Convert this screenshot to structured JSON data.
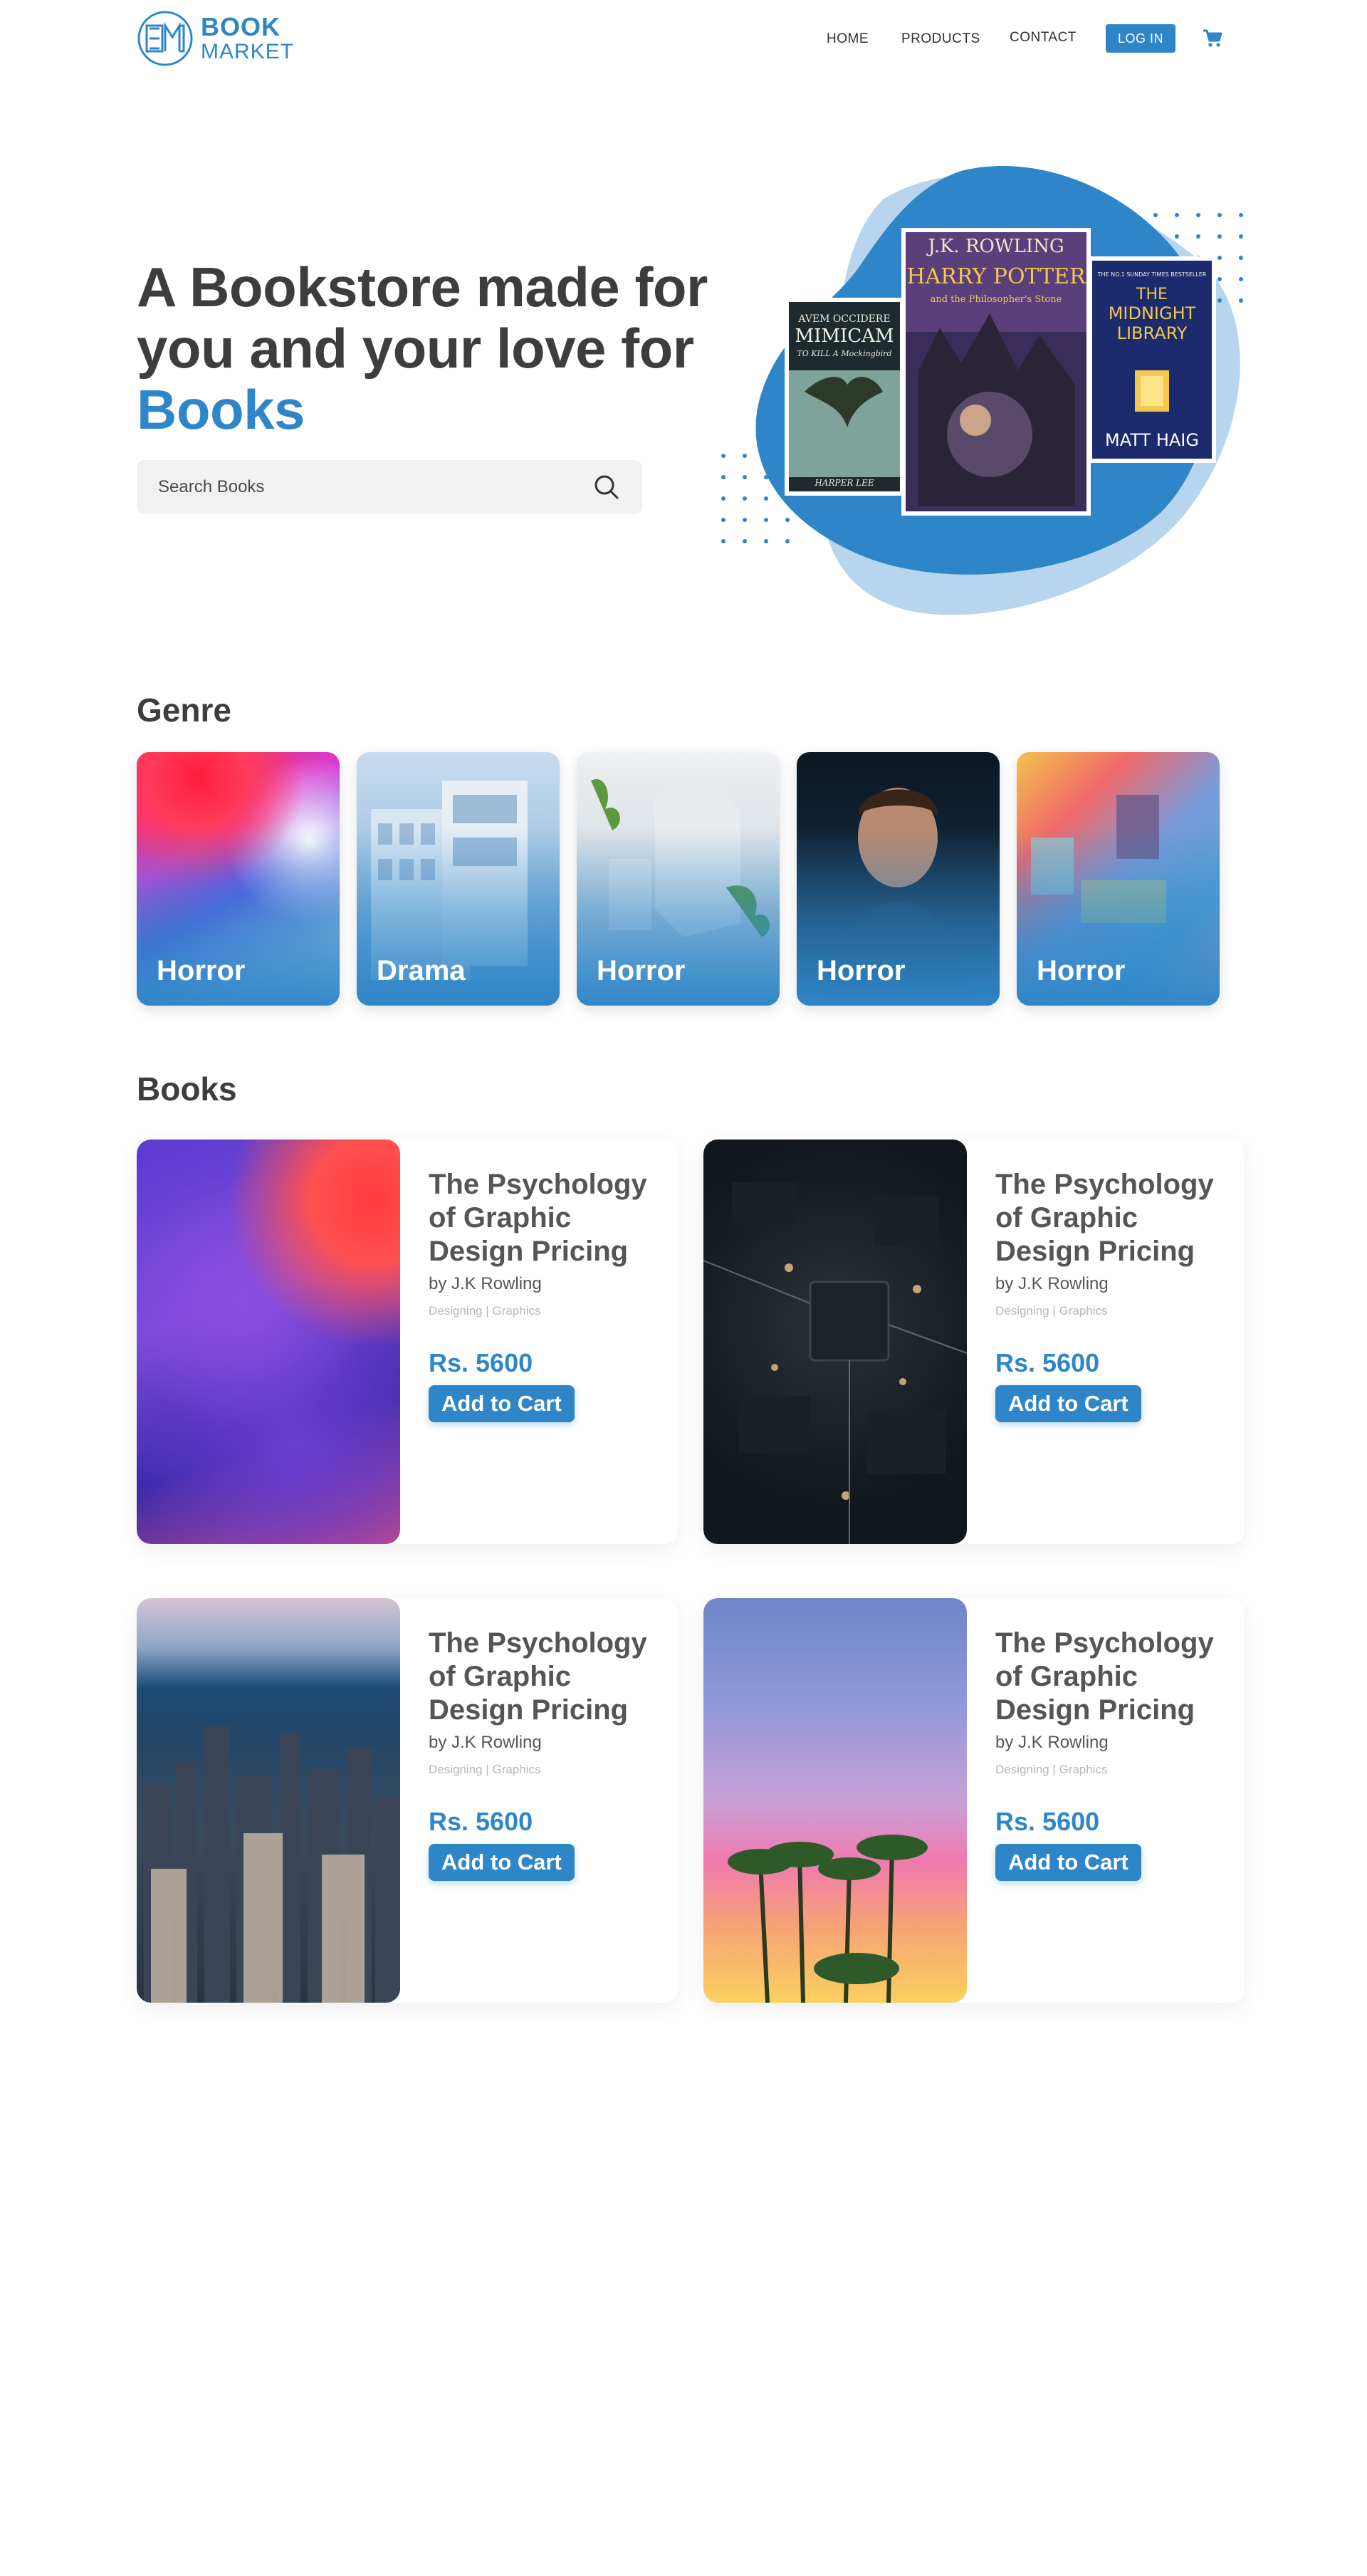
{
  "brand": {
    "line1": "BOOK",
    "line2": "MARKET"
  },
  "nav": {
    "home": "HOME",
    "products": "PRODUCTS",
    "contact": "CONTACT",
    "login": "LOG IN"
  },
  "hero": {
    "title_part1": "A Bookstore made for you and your love for ",
    "title_accent": "Books",
    "search_placeholder": "Search Books",
    "covers": {
      "mockingbird": {
        "line1": "AVEM OCCIDERE",
        "line2": "MIMICAM",
        "line3": "TO KILL A Mockingbird",
        "author": "HARPER LEE"
      },
      "potter": {
        "author": "J.K. ROWLING",
        "title": "HARRY POTTER",
        "subtitle": "and the Philosopher's Stone"
      },
      "midnight": {
        "top": "THE NO.1 SUNDAY TIMES BESTSELLER",
        "title1": "THE",
        "title2": "MIDNIGHT",
        "title3": "LIBRARY",
        "author": "MATT HAIG"
      }
    }
  },
  "genre": {
    "heading": "Genre",
    "items": [
      {
        "label": "Horror"
      },
      {
        "label": "Drama"
      },
      {
        "label": "Horror"
      },
      {
        "label": "Horror"
      },
      {
        "label": "Horror"
      }
    ]
  },
  "books": {
    "heading": "Books",
    "items": [
      {
        "title": "The Psychology of Graphic Design Pricing",
        "author": "by J.K Rowling",
        "tags": "Designing | Graphics",
        "price": "Rs. 5600",
        "cta": "Add to Cart"
      },
      {
        "title": "The Psychology of Graphic Design Pricing",
        "author": "by J.K Rowling",
        "tags": "Designing | Graphics",
        "price": "Rs. 5600",
        "cta": "Add to Cart"
      },
      {
        "title": "The Psychology of Graphic Design Pricing",
        "author": "by J.K Rowling",
        "tags": "Designing | Graphics",
        "price": "Rs. 5600",
        "cta": "Add to Cart"
      },
      {
        "title": "The Psychology of Graphic Design Pricing",
        "author": "by J.K Rowling",
        "tags": "Designing | Graphics",
        "price": "Rs. 5600",
        "cta": "Add to Cart"
      }
    ]
  },
  "theme": {
    "accent": "#2e86c8",
    "text": "#3d3d3d",
    "muted": "#b7b7b7"
  }
}
